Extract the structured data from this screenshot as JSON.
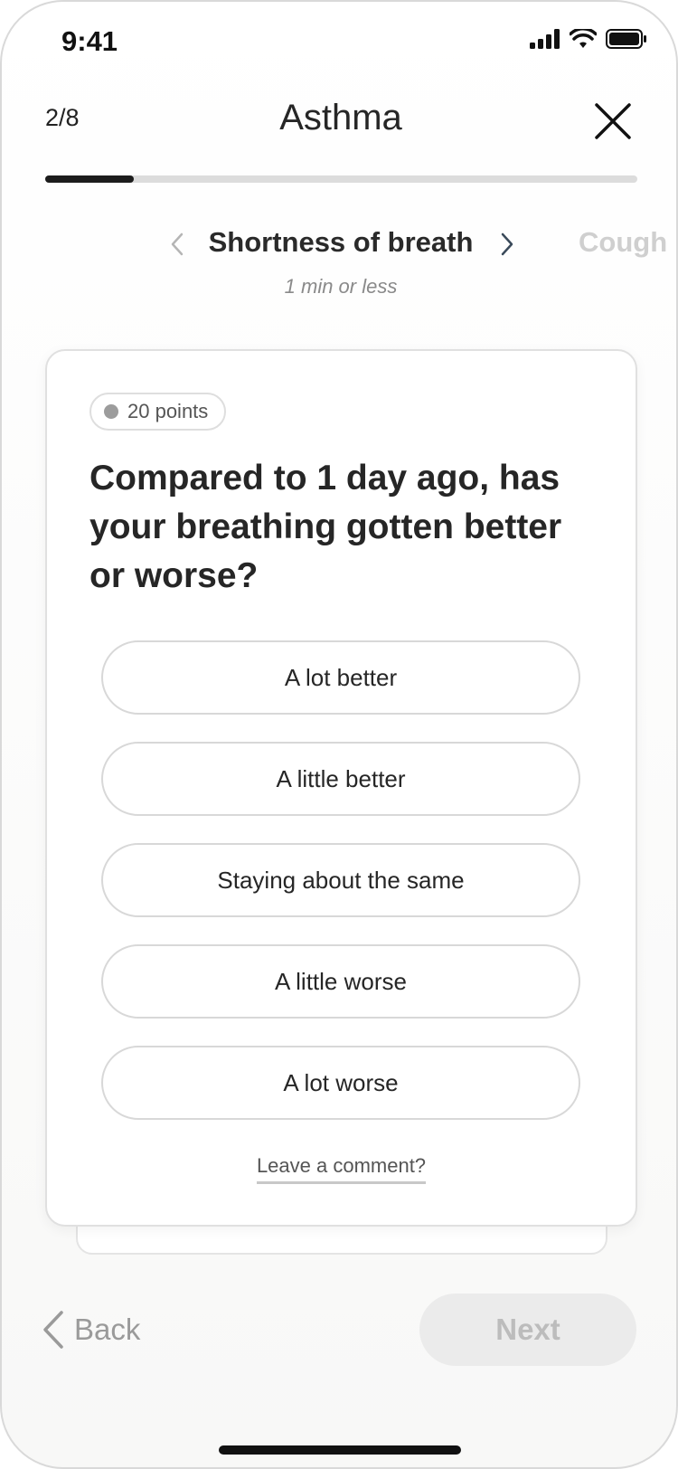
{
  "status_bar": {
    "time": "9:41"
  },
  "header": {
    "step_counter": "2/8",
    "title": "Asthma",
    "progress": 0.15
  },
  "topics": {
    "current": "Shortness of breath",
    "upcoming": "Cough",
    "duration": "1 min or less"
  },
  "question_card": {
    "points": "20 points",
    "question": "Compared to 1 day ago, has your breathing gotten better or worse?",
    "options": [
      "A lot better",
      "A little better",
      "Staying about the same",
      "A little worse",
      "A lot worse"
    ],
    "comment_link": "Leave a comment?"
  },
  "footer": {
    "back_label": "Back",
    "next_label": "Next"
  },
  "colors": {
    "progress_fill": "#1c1c1c",
    "progress_track": "#dcdcdc",
    "next_disabled_bg": "#ebebeb"
  }
}
